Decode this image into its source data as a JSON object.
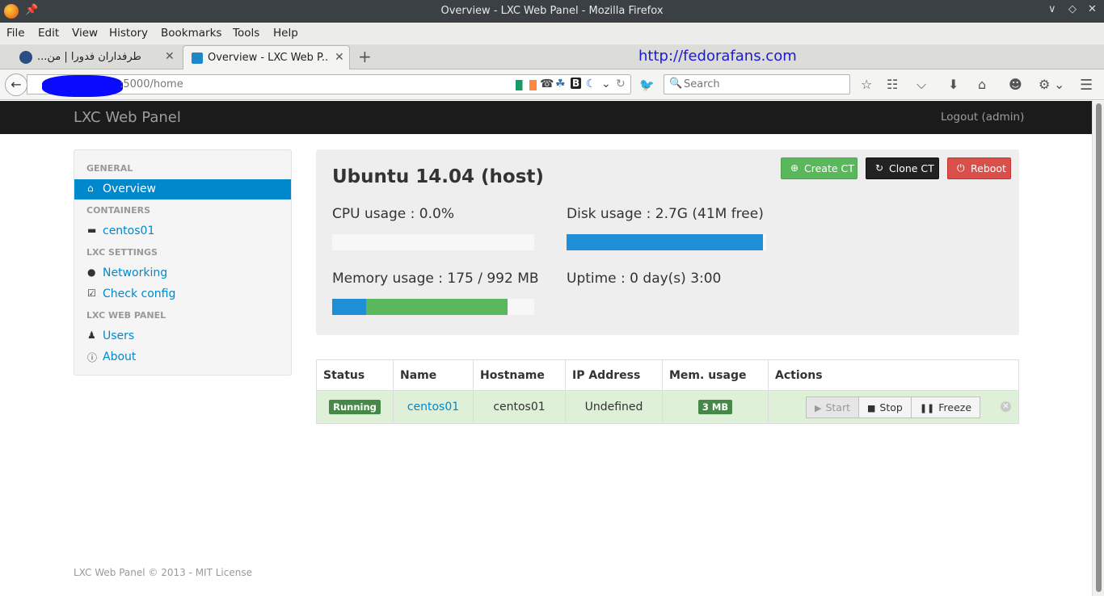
{
  "window": {
    "title": "Overview - LXC Web Panel - Mozilla Firefox"
  },
  "menu": [
    "File",
    "Edit",
    "View",
    "History",
    "Bookmarks",
    "Tools",
    "Help"
  ],
  "tabs": [
    {
      "label": "طرفداران فدورا | من...",
      "active": false
    },
    {
      "label": "Overview - LXC Web P...",
      "active": true
    }
  ],
  "overlay_text": "http://fedorafans.com",
  "address_bar": {
    "url": ":5000/home"
  },
  "search": {
    "placeholder": "Search"
  },
  "app": {
    "brand": "LXC Web Panel",
    "logout": "Logout (admin)",
    "footer": "LXC Web Panel © 2013 - MIT License"
  },
  "sidebar": {
    "sections": [
      {
        "header": "GENERAL",
        "items": [
          {
            "label": "Overview",
            "icon": "home-icon",
            "active": true
          }
        ]
      },
      {
        "header": "CONTAINERS",
        "items": [
          {
            "label": "centos01",
            "icon": "hdd-icon",
            "active": false
          }
        ]
      },
      {
        "header": "LXC SETTINGS",
        "items": [
          {
            "label": "Networking",
            "icon": "globe-icon",
            "active": false
          },
          {
            "label": "Check config",
            "icon": "check-icon",
            "active": false
          }
        ]
      },
      {
        "header": "LXC WEB PANEL",
        "items": [
          {
            "label": "Users",
            "icon": "user-icon",
            "active": false
          },
          {
            "label": "About",
            "icon": "info-icon",
            "active": false
          }
        ]
      }
    ]
  },
  "host": {
    "title": "Ubuntu 14.04 (host)",
    "buttons": {
      "create": "Create CT",
      "clone": "Clone CT",
      "reboot": "Reboot"
    },
    "cpu_label": "CPU usage : 0.0%",
    "cpu_fraction": 0.0,
    "disk_label": "Disk usage : 2.7G (41M free)",
    "disk_fraction": 0.985,
    "memory_label": "Memory usage : 175 / 992 MB",
    "memory_used_fraction": 0.168,
    "memory_cached_fraction": 0.7,
    "uptime_label": "Uptime : 0 day(s) 3:00"
  },
  "containers": {
    "headers": [
      "Status",
      "Name",
      "Hostname",
      "IP Address",
      "Mem. usage",
      "Actions"
    ],
    "rows": [
      {
        "status": "Running",
        "name": "centos01",
        "hostname": "centos01",
        "ip": "Undefined",
        "mem": "3 MB",
        "actions": {
          "start": "Start",
          "stop": "Stop",
          "freeze": "Freeze"
        }
      }
    ]
  },
  "colors": {
    "primary": "#0088cc",
    "success": "#5bb75b",
    "danger": "#da4f49",
    "navbar": "#1b1b1b"
  }
}
